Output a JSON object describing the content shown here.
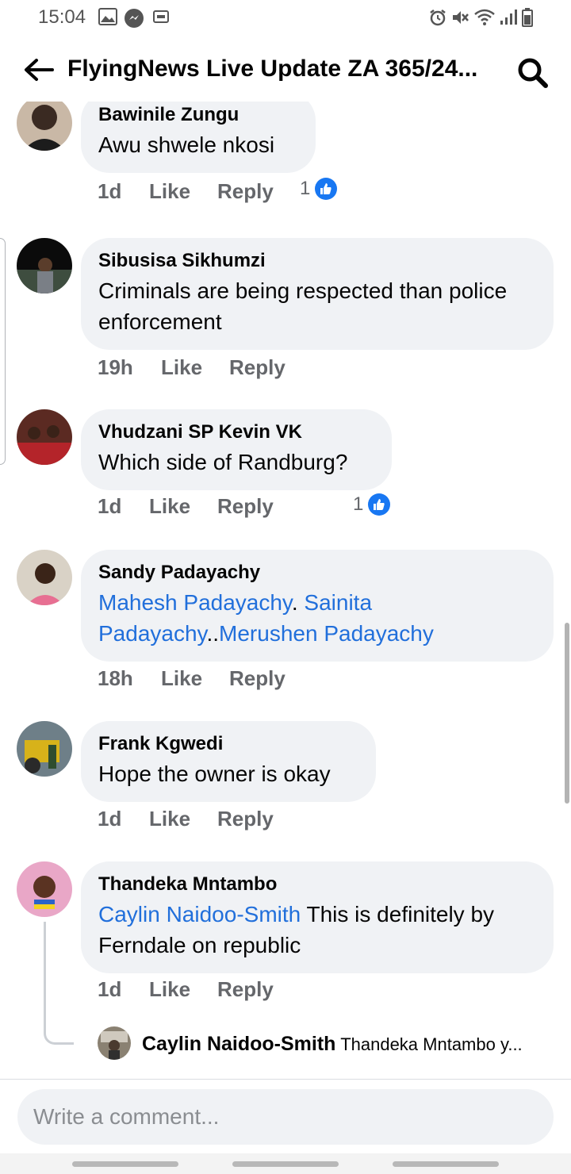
{
  "status_bar": {
    "time": "15:04"
  },
  "header": {
    "title": "FlyingNews Live Update ZA 365/24..."
  },
  "comments": [
    {
      "author": "Bawinile Zungu",
      "segments": [
        {
          "text": "Awu shwele nkosi",
          "mention": false
        }
      ],
      "time": "1d",
      "like": "Like",
      "reply": "Reply",
      "reactions": "1"
    },
    {
      "author": "Sibusisa Sikhumzi",
      "segments": [
        {
          "text": "Criminals are being respected than police enforcement",
          "mention": false
        }
      ],
      "time": "19h",
      "like": "Like",
      "reply": "Reply",
      "reactions": ""
    },
    {
      "author": "Vhudzani SP Kevin VK",
      "segments": [
        {
          "text": "Which side of Randburg?",
          "mention": false
        }
      ],
      "time": "1d",
      "like": "Like",
      "reply": "Reply",
      "reactions": "1"
    },
    {
      "author": "Sandy Padayachy",
      "segments": [
        {
          "text": "Mahesh Padayachy",
          "mention": true
        },
        {
          "text": ". ",
          "mention": false
        },
        {
          "text": "Sainita Padayachy",
          "mention": true
        },
        {
          "text": "..",
          "mention": false
        },
        {
          "text": "Merushen Padayachy",
          "mention": true
        }
      ],
      "time": "18h",
      "like": "Like",
      "reply": "Reply",
      "reactions": ""
    },
    {
      "author": "Frank Kgwedi",
      "segments": [
        {
          "text": "Hope the owner is okay",
          "mention": false
        }
      ],
      "time": "1d",
      "like": "Like",
      "reply": "Reply",
      "reactions": ""
    },
    {
      "author": "Thandeka Mntambo",
      "segments": [
        {
          "text": "Caylin Naidoo-Smith",
          "mention": true
        },
        {
          "text": " This is definitely by Ferndale on republic",
          "mention": false
        }
      ],
      "time": "1d",
      "like": "Like",
      "reply": "Reply",
      "reactions": ""
    }
  ],
  "reply_preview": {
    "author": "Caylin Naidoo-Smith",
    "text": "Thandeka Mntambo y..."
  },
  "composer": {
    "placeholder": "Write a comment..."
  },
  "colors": {
    "mention": "#216fdb",
    "like_badge": "#1877f2",
    "bubble": "#f0f2f5",
    "meta": "#65676b"
  },
  "icons": [
    "back-arrow-icon",
    "search-icon",
    "like-thumb-icon",
    "image-icon",
    "messenger-icon",
    "cast-icon",
    "alarm-icon",
    "mute-icon",
    "wifi-icon",
    "signal-icon",
    "battery-icon"
  ]
}
